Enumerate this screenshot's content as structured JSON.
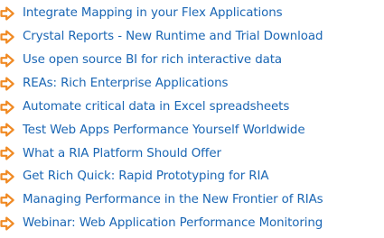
{
  "colors": {
    "link": "#1a66b4",
    "bullet_fill": "#ffffff",
    "bullet_stroke": "#f08a24",
    "background": "#ffffff"
  },
  "bullet_icon": "orange-arrow-right-icon",
  "links": [
    {
      "label": "Integrate Mapping in your Flex Applications"
    },
    {
      "label": "Crystal Reports - New Runtime and Trial Download"
    },
    {
      "label": "Use open source BI for rich interactive data"
    },
    {
      "label": "REAs: Rich Enterprise Applications"
    },
    {
      "label": "Automate critical data in Excel spreadsheets"
    },
    {
      "label": "Test Web Apps Performance Yourself Worldwide"
    },
    {
      "label": "What a RIA Platform Should Offer"
    },
    {
      "label": "Get Rich Quick: Rapid Prototyping for RIA"
    },
    {
      "label": "Managing Performance in the New Frontier of RIAs"
    },
    {
      "label": "Webinar: Web Application Performance Monitoring"
    }
  ]
}
